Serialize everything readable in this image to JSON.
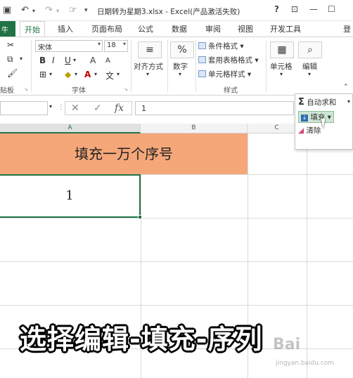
{
  "titlebar": {
    "title": "日期转为星期3.xlsx - Excel(产品激活失败)",
    "help": "?",
    "restore_ribbon": "⊡",
    "minimize": "—",
    "maximize": "☐"
  },
  "tabs": {
    "file_fragment": "牛",
    "home": "开始",
    "insert": "插入",
    "page_layout": "页面布局",
    "formulas": "公式",
    "data": "数据",
    "review": "审阅",
    "view": "视图",
    "developer": "开发工具",
    "signin_fragment": "登"
  },
  "ribbon": {
    "clipboard_label": "贴板",
    "font_name": "宋体",
    "font_size": "18",
    "bold": "B",
    "italic": "I",
    "underline": "U",
    "grow_font": "A",
    "shrink_font": "A",
    "font_label": "字体",
    "alignment_label": "对齐方式",
    "number_percent": "%",
    "number_label": "数字",
    "conditional_format": "条件格式",
    "table_format": "套用表格格式",
    "cell_styles": "单元格样式",
    "styles_label": "样式",
    "cells_label": "单元格",
    "editing_label": "编辑"
  },
  "formula_bar": {
    "cancel": "✕",
    "enter": "✓",
    "fx": "fx",
    "value": "1"
  },
  "columns": {
    "a": "A",
    "b": "B",
    "c": "C"
  },
  "cells": {
    "title": "填充一万个序号",
    "a2": "1"
  },
  "edit_menu": {
    "autosum": "自动求和",
    "fill": "填充",
    "clear": "清除"
  },
  "caption": "选择编辑-填充-序列",
  "watermark": {
    "logo": "Bai",
    "url": "jingyan.baidu.com"
  },
  "colors": {
    "excel_green": "#217346",
    "title_fill": "#f5a779",
    "fill_highlight": "#cfe6d4"
  }
}
